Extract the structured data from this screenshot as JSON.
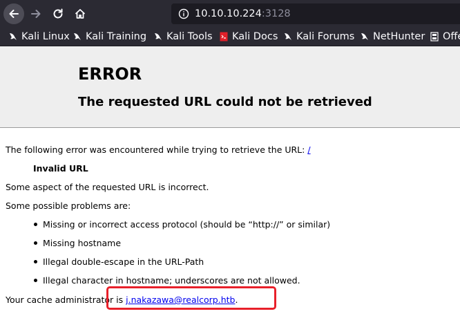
{
  "browser": {
    "url_host": "10.10.10.224",
    "url_port": ":3128",
    "bookmarks": [
      {
        "label": "Kali Linux",
        "icon": "kali-dragon-icon"
      },
      {
        "label": "Kali Training",
        "icon": "kali-dragon-icon"
      },
      {
        "label": "Kali Tools",
        "icon": "kali-dragon-icon"
      },
      {
        "label": "Kali Docs",
        "icon": "kali-docs-icon"
      },
      {
        "label": "Kali Forums",
        "icon": "kali-dragon-icon"
      },
      {
        "label": "NetHunter",
        "icon": "kali-dragon-icon"
      },
      {
        "label": "Offe",
        "icon": "offsec-icon"
      }
    ]
  },
  "page": {
    "title": "ERROR",
    "subtitle": "The requested URL could not be retrieved",
    "intro_prefix": "The following error was encountered while trying to retrieve the URL: ",
    "intro_link": "/",
    "error_name": "Invalid URL",
    "error_desc": "Some aspect of the requested URL is incorrect.",
    "problems_heading": "Some possible problems are:",
    "problems": [
      "Missing or incorrect access protocol (should be “http://” or similar)",
      "Missing hostname",
      "Illegal double-escape in the URL-Path",
      "Illegal character in hostname; underscores are not allowed."
    ],
    "admin_prefix": "Your cache administrator is ",
    "admin_email": "j.nakazawa@realcorp.htb",
    "admin_suffix": "."
  },
  "colors": {
    "toolbar_bg": "#2b2a33",
    "header_bg": "#eeeeee",
    "link": "#0000ee",
    "highlight": "#e8202a"
  }
}
